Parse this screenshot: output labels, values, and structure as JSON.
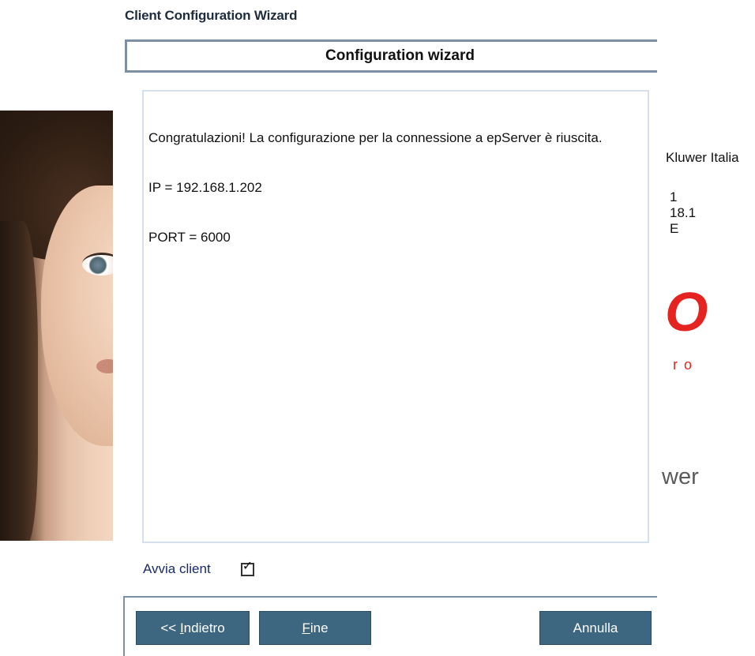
{
  "window": {
    "title": "Client Configuration Wizard"
  },
  "background": {
    "company": "Kluwer Italia",
    "lines": [
      "1",
      "18.1",
      "E"
    ],
    "logo_mark": "O",
    "logo_sub": "ro",
    "power_text": "wer"
  },
  "dialog": {
    "header": "Configuration wizard",
    "message": {
      "lines": [
        "Congratulazioni! La configurazione per la connessione a epServer è riuscita.",
        "IP = 192.168.1.202",
        "PORT = 6000"
      ]
    },
    "start_client": {
      "label": "Avvia client",
      "checked": true,
      "check_glyph": "✓"
    },
    "buttons": {
      "back_prefix": "<< ",
      "back_accel": "I",
      "back_rest": "ndietro",
      "finish_accel": "F",
      "finish_rest": "ine",
      "cancel": "Annulla"
    }
  },
  "colors": {
    "button_bg": "#3d6781",
    "header_border": "#7c8fa3",
    "logo_red": "#e52421"
  }
}
